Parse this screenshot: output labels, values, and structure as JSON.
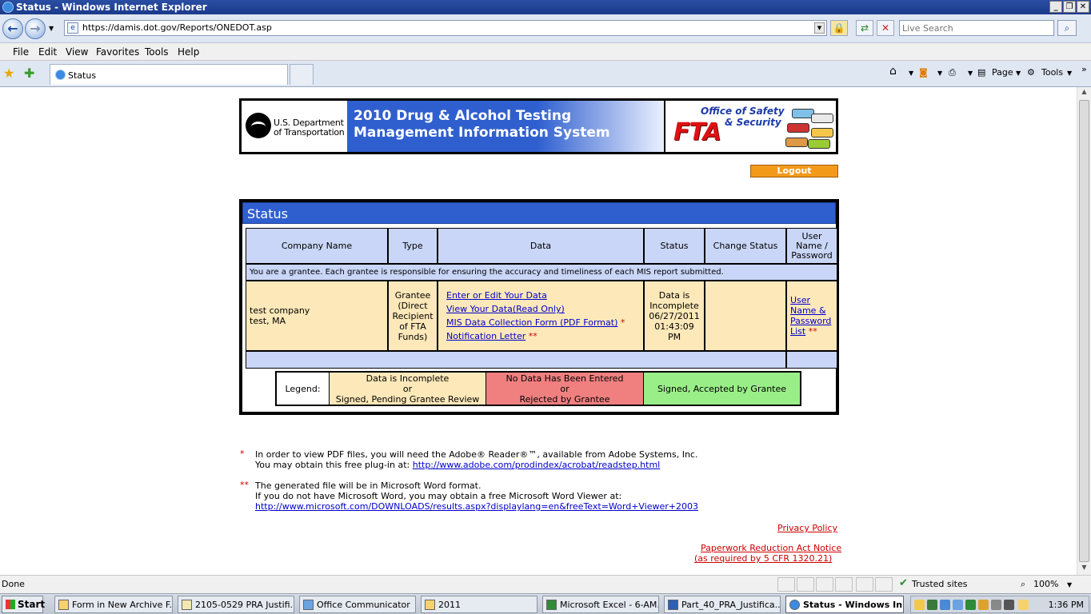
{
  "window": {
    "title": "Status - Windows Internet Explorer",
    "url": "https://damis.dot.gov/Reports/ONEDOT.asp",
    "search_placeholder": "Live Search",
    "menus": [
      "File",
      "Edit",
      "View",
      "Favorites",
      "Tools",
      "Help"
    ],
    "tab_title": "Status",
    "cmd_page": "Page",
    "cmd_tools": "Tools"
  },
  "banner": {
    "dot_line1": "U.S. Department",
    "dot_line2": "of Transportation",
    "mis_line1": "2010 Drug & Alcohol Testing",
    "mis_line2": "Management Information System",
    "office_line1": "Office of Safety",
    "office_line2": "& Security",
    "fta": "FTA"
  },
  "logout_label": "Logout",
  "status": {
    "title": "Status",
    "headers": [
      "Company Name",
      "Type",
      "Data",
      "Status",
      "Change Status",
      "User Name / Password"
    ],
    "grantee_note": "You are a grantee.  Each grantee is responsible for ensuring the accuracy and timeliness of each MIS report submitted.",
    "row": {
      "company_line1": "test company",
      "company_line2": "test, MA",
      "type": "Grantee (Direct Recipient of FTA Funds)",
      "links": {
        "enter": "Enter or Edit Your Data",
        "view": "View Your Data(Read Only)",
        "form": "MIS Data Collection Form (PDF Format)",
        "letter": "Notification Letter"
      },
      "status_text": "Data is Incomplete 06/27/2011 01:43:09 PM",
      "user_link": "User Name & Password List"
    },
    "star1": "*",
    "star2": "**"
  },
  "legend": {
    "label": "Legend:",
    "incomplete_line1": "Data is Incomplete",
    "incomplete_line2": "or",
    "incomplete_line3": "Signed, Pending Grantee Review",
    "nodata_line1": "No Data Has Been Entered",
    "nodata_line2": "or",
    "nodata_line3": "Rejected by Grantee",
    "signed": "Signed, Accepted by Grantee",
    "colors": {
      "incomplete": "#fde8b9",
      "nodata": "#f08080",
      "signed": "#99ee88"
    }
  },
  "notes": {
    "star1": "*",
    "note1_line1": "In order to view PDF files, you will need the Adobe® Reader®™, available from Adobe Systems, Inc.",
    "note1_line2_prefix": "You may obtain this free plug-in at: ",
    "note1_link": "http://www.adobe.com/prodindex/acrobat/readstep.html",
    "star2": "**",
    "note2_line1": "The generated file will be in Microsoft Word format.",
    "note2_line2": "If you do not have Microsoft Word, you may obtain a free Microsoft Word Viewer at:",
    "note2_link": "http://www.microsoft.com/DOWNLOADS/results.aspx?displaylang=en&freeText=Word+Viewer+2003"
  },
  "footer": {
    "privacy": "Privacy Policy",
    "paperwork1": "Paperwork Reduction Act Notice",
    "paperwork2": "(as required by 5 CFR 1320.21)"
  },
  "statusbar": {
    "left": "Done",
    "zone": "Trusted sites",
    "zoom": "100%"
  },
  "taskbar": {
    "start": "Start",
    "items": [
      "Form in New Archive F...",
      "2105-0529 PRA Justifi...",
      "Office Communicator",
      "2011",
      "Microsoft Excel - 6-AM...",
      "Part_40_PRA_Justifica...",
      "Status - Windows In..."
    ],
    "clock": "1:36 PM"
  }
}
